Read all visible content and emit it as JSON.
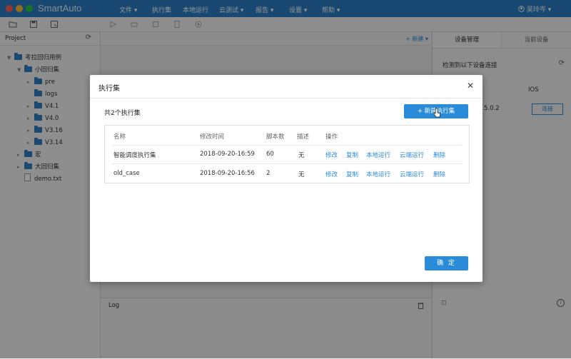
{
  "app": {
    "title": "SmartAuto",
    "user": "吴玲岑"
  },
  "menu": [
    "文件",
    "执行集",
    "本地运行",
    "云测试",
    "报告",
    "设置",
    "帮助"
  ],
  "colors": {
    "titlebar": "#2b7fc4",
    "accent": "#2a8bd8",
    "link": "#2a8bd8"
  },
  "sidebar": {
    "title": "Project",
    "tree": [
      {
        "label": "考拉回归用例",
        "type": "folder"
      },
      {
        "label": "小回归集",
        "type": "folder"
      },
      {
        "label": "pre",
        "type": "folder"
      },
      {
        "label": "logs",
        "type": "folder"
      },
      {
        "label": "V4.1",
        "type": "folder"
      },
      {
        "label": "V4.0",
        "type": "folder"
      },
      {
        "label": "V3.16",
        "type": "folder"
      },
      {
        "label": "V3.14",
        "type": "folder"
      },
      {
        "label": "宏",
        "type": "folder"
      },
      {
        "label": "大回归集",
        "type": "folder"
      },
      {
        "label": "demo.txt",
        "type": "file"
      }
    ]
  },
  "editor": {
    "new_label": "+ 新建"
  },
  "log": {
    "title": "Log"
  },
  "right_panel": {
    "tab_devices": "设备管理",
    "tab_current": "当前设备",
    "detect_text": "检测到以下设备连接",
    "ios_tab": "IOS",
    "version_partial": "5.0.2",
    "connect_label": "连接"
  },
  "modal": {
    "title": "执行集",
    "count_text": "共2个执行集",
    "new_button": "+ 新建执行集",
    "confirm_button": "确 定",
    "columns": [
      "名称",
      "修改时间",
      "脚本数",
      "描述",
      "操作"
    ],
    "rows": [
      {
        "name": "智能调度执行集",
        "time": "2018-09-20-16:59",
        "scripts": "60",
        "desc": "无"
      },
      {
        "name": "old_case",
        "time": "2018-09-20-16:56",
        "scripts": "2",
        "desc": "无"
      }
    ],
    "actions": [
      "修改",
      "复制",
      "本地运行",
      "云端运行",
      "删除"
    ]
  }
}
